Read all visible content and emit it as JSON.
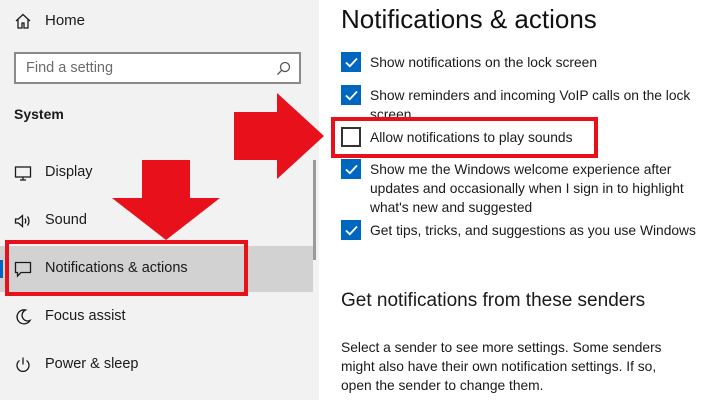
{
  "sidebar": {
    "home_label": "Home",
    "search_placeholder": "Find a setting",
    "section_label": "System",
    "items": [
      {
        "label": "Display",
        "icon": "display-icon"
      },
      {
        "label": "Sound",
        "icon": "sound-icon"
      },
      {
        "label": "Notifications & actions",
        "icon": "notifications-icon",
        "active": true
      },
      {
        "label": "Focus assist",
        "icon": "focus-assist-icon"
      },
      {
        "label": "Power & sleep",
        "icon": "power-icon"
      }
    ]
  },
  "main": {
    "title": "Notifications & actions",
    "options": [
      {
        "label": "Show notifications on the lock screen",
        "checked": true
      },
      {
        "label": "Show reminders and incoming VoIP calls on the lock screen",
        "checked": true
      },
      {
        "label": "Allow notifications to play sounds",
        "checked": false
      },
      {
        "label": "Show me the Windows welcome experience after updates and occasionally when I sign in to highlight what's new and suggested",
        "checked": true
      },
      {
        "label": "Get tips, tricks, and suggestions as you use Windows",
        "checked": true
      }
    ],
    "senders_heading": "Get notifications from these senders",
    "senders_description": "Select a sender to see more settings. Some senders might also have their own notification settings. If so, open the sender to change them."
  },
  "colors": {
    "accent": "#0067c0",
    "annotation": "#e8101a",
    "sidebar_bg": "#f2f2f2",
    "active_bg": "#d2d2d2"
  }
}
